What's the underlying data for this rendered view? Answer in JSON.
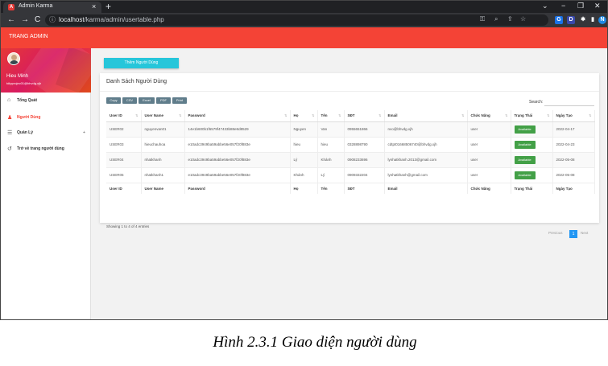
{
  "browser": {
    "tab_title": "Admin Karma",
    "tab_favicon": "A",
    "tab_close": "×",
    "new_tab": "+",
    "url_host": "localhost",
    "url_path": "/karma/admin/usertable.php",
    "nav": {
      "back": "←",
      "forward": "→",
      "reload": "C"
    },
    "window": {
      "chevron": "⌄",
      "minimize": "−",
      "maximize": "❐",
      "close": "✕"
    },
    "profile_initial": "N",
    "extensions": [
      "G",
      "D",
      "✱",
      "▮",
      "N"
    ]
  },
  "app": {
    "brand": "TRANG ADMIN",
    "user": {
      "name": "Hieu Minh",
      "email": "tdtpprojec01@bhvdg.xjh"
    },
    "menu": [
      {
        "label": "Tổng Quát",
        "icon": "home-icon",
        "glyph": "⌂"
      },
      {
        "label": "Người Dùng",
        "icon": "user-icon",
        "glyph": "♟"
      },
      {
        "label": "Quản Lý",
        "icon": "list-icon",
        "glyph": "☰",
        "caret": "+"
      },
      {
        "label": "Trở về trang người dùng",
        "icon": "history-icon",
        "glyph": "↺"
      }
    ]
  },
  "content": {
    "add_button": "Thêm Người Dùng",
    "card_title": "Danh Sách Người Dùng",
    "export_buttons": [
      "Copy",
      "CSV",
      "Excel",
      "PDF",
      "Print"
    ],
    "search_label": "Search:",
    "columns": [
      "User ID",
      "User Name",
      "Password",
      "Họ",
      "Tên",
      "SĐT",
      "Email",
      "Chức Năng",
      "Trạng Thái",
      "Ngày Tạo"
    ],
    "rows": [
      [
        "USER02",
        "nguyenvan01",
        "14e1b600b1f6579f47433b88e8d8529",
        "Nguyen",
        "Van",
        "0955651866",
        "nvo@bhvdg.xjh",
        "user",
        "Available",
        "2022-04-17"
      ],
      [
        "USER03",
        "hieuchauhoa",
        "e10adc3949ba59abbe56e057f20f883e",
        "hieu",
        "hieu",
        "0328898790",
        "cdtpt01668506740@bhvdg.xjh",
        "user",
        "Available",
        "2022-04-23"
      ],
      [
        "USER04",
        "nhatkhanh",
        "e10adc3949ba59abbe56e057f20f883e",
        "Lý",
        "Khánh",
        "0908233696",
        "lynhatkhanh.2013@gmail.com",
        "user",
        "Available",
        "2022-05-08"
      ],
      [
        "USER05",
        "nhatkhanh1",
        "e10adc3949ba59abbe56e057f20f883e",
        "Khánh",
        "Lý",
        "0909332204",
        "lynhatkhanh@gmail.com",
        "user",
        "Available",
        "2022-05-08"
      ]
    ],
    "info": "Showing 1 to 4 of 4 entries",
    "pager": {
      "previous": "Previous",
      "page": "1",
      "next": "Next"
    },
    "status_color": "#43a047"
  },
  "caption": "Hình 2.3.1 Giao diện người dùng",
  "colors": {
    "topbar": "#f44336",
    "add_button": "#26c6da",
    "export": "#607d8b",
    "pager_active": "#2196f3"
  }
}
